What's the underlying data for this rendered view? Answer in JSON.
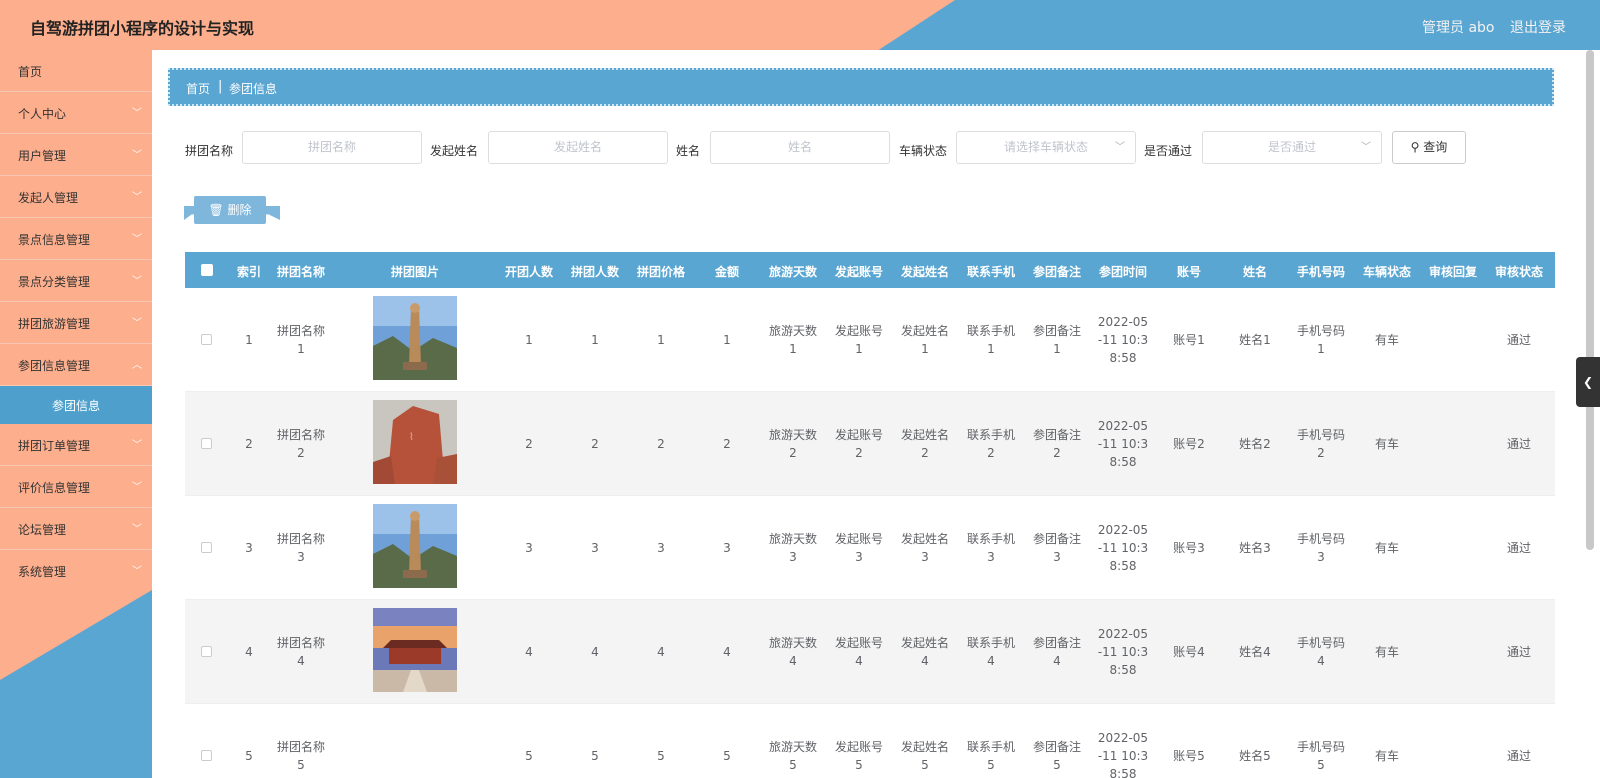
{
  "header": {
    "title": "自驾游拼团小程序的设计与实现",
    "admin": "管理员 abo",
    "logout": "退出登录"
  },
  "sidebar": {
    "items": [
      {
        "label": "首页",
        "expandable": false
      },
      {
        "label": "个人中心",
        "expandable": true
      },
      {
        "label": "用户管理",
        "expandable": true
      },
      {
        "label": "发起人管理",
        "expandable": true
      },
      {
        "label": "景点信息管理",
        "expandable": true
      },
      {
        "label": "景点分类管理",
        "expandable": true
      },
      {
        "label": "拼团旅游管理",
        "expandable": true
      },
      {
        "label": "参团信息管理",
        "expandable": true
      }
    ],
    "active_sub": "参团信息",
    "items_after": [
      {
        "label": "拼团订单管理"
      },
      {
        "label": "评价信息管理"
      },
      {
        "label": "论坛管理"
      },
      {
        "label": "系统管理"
      }
    ]
  },
  "breadcrumb": {
    "home": "首页",
    "separator": "|",
    "current": "参团信息"
  },
  "filters": {
    "group_name_label": "拼团名称",
    "group_name_placeholder": "拼团名称",
    "initiator_label": "发起姓名",
    "initiator_placeholder": "发起姓名",
    "name_label": "姓名",
    "name_placeholder": "姓名",
    "vehicle_label": "车辆状态",
    "vehicle_placeholder": "请选择车辆状态",
    "approved_label": "是否通过",
    "approved_placeholder": "是否通过",
    "search_label": "查询"
  },
  "actions": {
    "delete_label": "删除"
  },
  "table": {
    "columns": [
      "索引",
      "拼团名称",
      "拼团图片",
      "开团人数",
      "拼团人数",
      "拼团价格",
      "金额",
      "旅游天数",
      "发起账号",
      "发起姓名",
      "联系手机",
      "参团备注",
      "参团时间",
      "账号",
      "姓名",
      "手机号码",
      "车辆状态",
      "审核回复",
      "审核状态"
    ],
    "rows": [
      {
        "index": "1",
        "group_name": "拼团名称\n1",
        "image": "pagoda",
        "open": "1",
        "joined": "1",
        "price": "1",
        "amount": "1",
        "days": "旅游天数\n1",
        "init_account": "发起账号\n1",
        "init_name": "发起姓名\n1",
        "phone": "联系手机\n1",
        "remark": "参团备注\n1",
        "time": "2022-05\n-11 10:3\n8:58",
        "account": "账号1",
        "name": "姓名1",
        "mobile": "手机号码\n1",
        "vehicle": "有车",
        "reply": "",
        "status": "通过"
      },
      {
        "index": "2",
        "group_name": "拼团名称\n2",
        "image": "rock",
        "open": "2",
        "joined": "2",
        "price": "2",
        "amount": "2",
        "days": "旅游天数\n2",
        "init_account": "发起账号\n2",
        "init_name": "发起姓名\n2",
        "phone": "联系手机\n2",
        "remark": "参团备注\n2",
        "time": "2022-05\n-11 10:3\n8:58",
        "account": "账号2",
        "name": "姓名2",
        "mobile": "手机号码\n2",
        "vehicle": "有车",
        "reply": "",
        "status": "通过"
      },
      {
        "index": "3",
        "group_name": "拼团名称\n3",
        "image": "pagoda",
        "open": "3",
        "joined": "3",
        "price": "3",
        "amount": "3",
        "days": "旅游天数\n3",
        "init_account": "发起账号\n3",
        "init_name": "发起姓名\n3",
        "phone": "联系手机\n3",
        "remark": "参团备注\n3",
        "time": "2022-05\n-11 10:3\n8:58",
        "account": "账号3",
        "name": "姓名3",
        "mobile": "手机号码\n3",
        "vehicle": "有车",
        "reply": "",
        "status": "通过"
      },
      {
        "index": "4",
        "group_name": "拼团名称\n4",
        "image": "temple",
        "open": "4",
        "joined": "4",
        "price": "4",
        "amount": "4",
        "days": "旅游天数\n4",
        "init_account": "发起账号\n4",
        "init_name": "发起姓名\n4",
        "phone": "联系手机\n4",
        "remark": "参团备注\n4",
        "time": "2022-05\n-11 10:3\n8:58",
        "account": "账号4",
        "name": "姓名4",
        "mobile": "手机号码\n4",
        "vehicle": "有车",
        "reply": "",
        "status": "通过"
      },
      {
        "index": "5",
        "group_name": "拼团名称\n5",
        "image": "none",
        "open": "5",
        "joined": "5",
        "price": "5",
        "amount": "5",
        "days": "旅游天数\n5",
        "init_account": "发起账号\n5",
        "init_name": "发起姓名\n5",
        "phone": "联系手机\n5",
        "remark": "参团备注\n5",
        "time": "2022-05\n-11 10:3\n8:58",
        "account": "账号5",
        "name": "姓名5",
        "mobile": "手机号码\n5",
        "vehicle": "有车",
        "reply": "",
        "status": "通过"
      }
    ]
  },
  "colors": {
    "peach": "#fdae8c",
    "blue": "#5aa6d2",
    "delete": "#7fb7dc"
  }
}
